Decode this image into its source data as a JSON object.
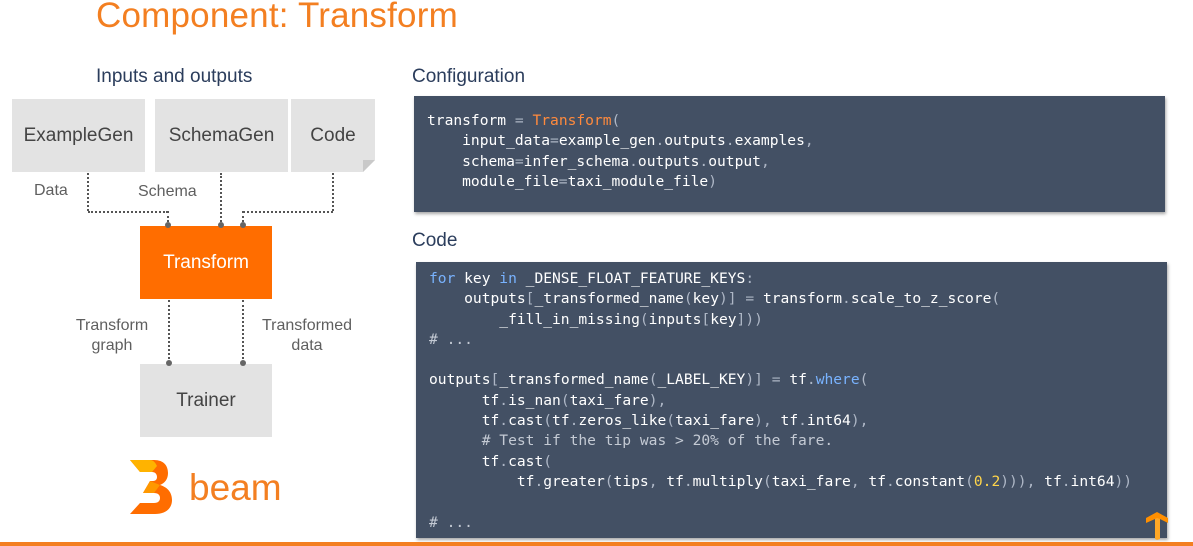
{
  "slide": {
    "title": "Component: Transform",
    "io_heading": "Inputs and outputs",
    "config_heading": "Configuration",
    "code_heading": "Code"
  },
  "diagram": {
    "nodes": {
      "examplegen": "ExampleGen",
      "schemagen": "SchemaGen",
      "code": "Code",
      "transform": "Transform",
      "trainer": "Trainer"
    },
    "edge_labels": {
      "data": "Data",
      "schema": "Schema",
      "transform_graph_line1": "Transform",
      "transform_graph_line2": "graph",
      "transformed_data_line1": "Transformed",
      "transformed_data_line2": "data"
    },
    "colors": {
      "accent": "#ff6d00",
      "node_gray": "#e3e3e3",
      "code_bg": "#435064"
    }
  },
  "logo": {
    "text": "beam",
    "color": "#f37f21"
  },
  "config_code": [
    [
      [
        "transform ",
        ""
      ],
      [
        "=",
        "p"
      ],
      [
        " ",
        ""
      ],
      [
        "Transform",
        "fn"
      ],
      [
        "(",
        "p"
      ]
    ],
    [
      [
        "    input_data",
        ""
      ],
      [
        "=",
        "p"
      ],
      [
        "example_gen",
        ""
      ],
      [
        ".",
        "p"
      ],
      [
        "outputs",
        ""
      ],
      [
        ".",
        "p"
      ],
      [
        "examples",
        ""
      ],
      [
        ",",
        "p"
      ]
    ],
    [
      [
        "    schema",
        ""
      ],
      [
        "=",
        "p"
      ],
      [
        "infer_schema",
        ""
      ],
      [
        ".",
        "p"
      ],
      [
        "outputs",
        ""
      ],
      [
        ".",
        "p"
      ],
      [
        "output",
        ""
      ],
      [
        ",",
        "p"
      ]
    ],
    [
      [
        "    module_file",
        ""
      ],
      [
        "=",
        "p"
      ],
      [
        "taxi_module_file",
        ""
      ],
      [
        ")",
        "p"
      ]
    ]
  ],
  "main_code": [
    [
      [
        "for",
        "kw"
      ],
      [
        " key ",
        ""
      ],
      [
        "in",
        "kw"
      ],
      [
        " _DENSE_FLOAT_FEATURE_KEYS",
        ""
      ],
      [
        ":",
        "p"
      ]
    ],
    [
      [
        "    outputs",
        ""
      ],
      [
        "[",
        "p"
      ],
      [
        "_transformed_name",
        ""
      ],
      [
        "(",
        "p"
      ],
      [
        "key",
        ""
      ],
      [
        ")]",
        "p"
      ],
      [
        " ",
        ""
      ],
      [
        "=",
        "p"
      ],
      [
        " transform",
        ""
      ],
      [
        ".",
        "p"
      ],
      [
        "scale_to_z_score",
        ""
      ],
      [
        "(",
        "p"
      ]
    ],
    [
      [
        "        _fill_in_missing",
        ""
      ],
      [
        "(",
        "p"
      ],
      [
        "inputs",
        ""
      ],
      [
        "[",
        "p"
      ],
      [
        "key",
        ""
      ],
      [
        "]))",
        "p"
      ]
    ],
    [
      [
        "# ...",
        "cm"
      ]
    ],
    [
      [
        "",
        ""
      ]
    ],
    [
      [
        "outputs",
        ""
      ],
      [
        "[",
        "p"
      ],
      [
        "_transformed_name",
        ""
      ],
      [
        "(",
        "p"
      ],
      [
        "_LABEL_KEY",
        ""
      ],
      [
        ")]",
        "p"
      ],
      [
        " ",
        ""
      ],
      [
        "=",
        "p"
      ],
      [
        " tf",
        ""
      ],
      [
        ".",
        "p"
      ],
      [
        "where",
        "kw"
      ],
      [
        "(",
        "p"
      ]
    ],
    [
      [
        "      tf",
        ""
      ],
      [
        ".",
        "p"
      ],
      [
        "is_nan",
        ""
      ],
      [
        "(",
        "p"
      ],
      [
        "taxi_fare",
        ""
      ],
      [
        "),",
        "p"
      ]
    ],
    [
      [
        "      tf",
        ""
      ],
      [
        ".",
        "p"
      ],
      [
        "cast",
        ""
      ],
      [
        "(",
        "p"
      ],
      [
        "tf",
        ""
      ],
      [
        ".",
        "p"
      ],
      [
        "zeros_like",
        ""
      ],
      [
        "(",
        "p"
      ],
      [
        "taxi_fare",
        ""
      ],
      [
        "),",
        "p"
      ],
      [
        " tf",
        ""
      ],
      [
        ".",
        "p"
      ],
      [
        "int64",
        ""
      ],
      [
        "),",
        "p"
      ]
    ],
    [
      [
        "      # Test if the tip was > 20% of the fare.",
        "cm"
      ]
    ],
    [
      [
        "      tf",
        ""
      ],
      [
        ".",
        "p"
      ],
      [
        "cast",
        ""
      ],
      [
        "(",
        "p"
      ]
    ],
    [
      [
        "          tf",
        ""
      ],
      [
        ".",
        "p"
      ],
      [
        "greater",
        ""
      ],
      [
        "(",
        "p"
      ],
      [
        "tips",
        ""
      ],
      [
        ",",
        "p"
      ],
      [
        " tf",
        ""
      ],
      [
        ".",
        "p"
      ],
      [
        "multiply",
        ""
      ],
      [
        "(",
        "p"
      ],
      [
        "taxi_fare",
        ""
      ],
      [
        ",",
        "p"
      ],
      [
        " tf",
        ""
      ],
      [
        ".",
        "p"
      ],
      [
        "constant",
        ""
      ],
      [
        "(",
        "p"
      ],
      [
        "0.2",
        "num"
      ],
      [
        "))),",
        "p"
      ],
      [
        " tf",
        ""
      ],
      [
        ".",
        "p"
      ],
      [
        "int64",
        ""
      ],
      [
        "))",
        "p"
      ]
    ],
    [
      [
        "",
        ""
      ]
    ],
    [
      [
        "# ...",
        "cm"
      ]
    ]
  ]
}
